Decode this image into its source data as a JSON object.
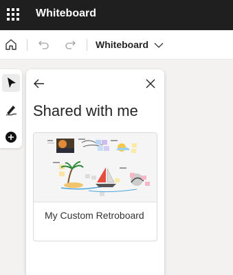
{
  "app": {
    "title": "Whiteboard"
  },
  "toolbar": {
    "board_name": "Whiteboard"
  },
  "panel": {
    "title": "Shared with me",
    "cards": [
      {
        "title": "My Custom Retroboard"
      }
    ]
  },
  "colors": {
    "titlebar_bg": "#1f1f1f",
    "page_bg": "#f3f2f1",
    "panel_bg": "#ffffff"
  },
  "icons": {
    "waffle": "app-launcher-icon",
    "home": "home-icon",
    "undo": "undo-icon",
    "redo": "redo-icon",
    "dropdown": "chevron-down-icon",
    "select": "pointer-icon",
    "pen": "pen-icon",
    "add": "add-circle-icon",
    "back": "arrow-left-icon",
    "close": "close-icon"
  }
}
